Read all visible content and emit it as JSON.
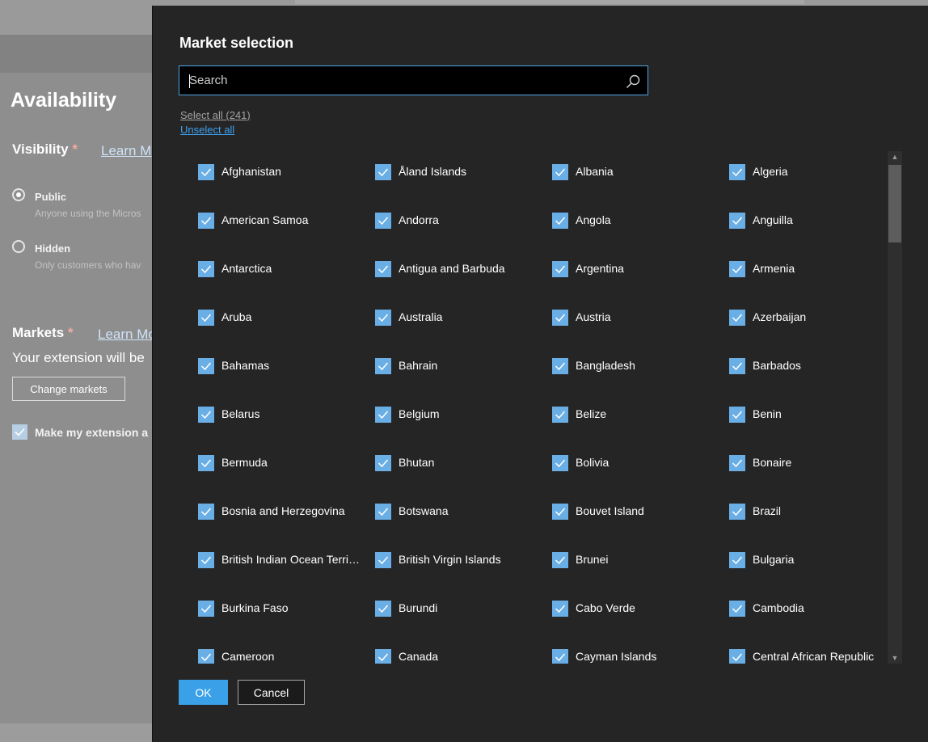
{
  "background": {
    "heading": "Availability",
    "visibility": {
      "label": "Visibility",
      "required_mark": "*",
      "learn_more": "Learn M"
    },
    "options": [
      {
        "label": "Public",
        "sub": "Anyone using the Micros",
        "selected": true
      },
      {
        "label": "Hidden",
        "sub": "Only customers who hav",
        "selected": false
      }
    ],
    "markets": {
      "label": "Markets",
      "required_mark": "*",
      "learn_more": "Learn Mo",
      "text": "Your extension will be",
      "button": "Change markets"
    },
    "make_available": {
      "label": "Make my extension a",
      "checked": true
    }
  },
  "dialog": {
    "title": "Market selection",
    "search": {
      "placeholder": "Search",
      "value": ""
    },
    "select_all": "Select all (241)",
    "unselect_all": "Unselect all",
    "countries": [
      "Afghanistan",
      "Åland Islands",
      "Albania",
      "Algeria",
      "American Samoa",
      "Andorra",
      "Angola",
      "Anguilla",
      "Antarctica",
      "Antigua and Barbuda",
      "Argentina",
      "Armenia",
      "Aruba",
      "Australia",
      "Austria",
      "Azerbaijan",
      "Bahamas",
      "Bahrain",
      "Bangladesh",
      "Barbados",
      "Belarus",
      "Belgium",
      "Belize",
      "Benin",
      "Bermuda",
      "Bhutan",
      "Bolivia",
      "Bonaire",
      "Bosnia and Herzegovina",
      "Botswana",
      "Bouvet Island",
      "Brazil",
      "British Indian Ocean Territory",
      "British Virgin Islands",
      "Brunei",
      "Bulgaria",
      "Burkina Faso",
      "Burundi",
      "Cabo Verde",
      "Cambodia",
      "Cameroon",
      "Canada",
      "Cayman Islands",
      "Central African Republic"
    ],
    "all_checked": true,
    "ok_label": "OK",
    "cancel_label": "Cancel"
  },
  "colors": {
    "dialog_bg": "#252526",
    "accent": "#3aa1e8",
    "checkbox": "#6aaee6",
    "overlay": "#8e8e8e"
  },
  "icons": [
    "search-icon",
    "checkmark-icon",
    "chevron-up-icon",
    "chevron-down-icon"
  ]
}
